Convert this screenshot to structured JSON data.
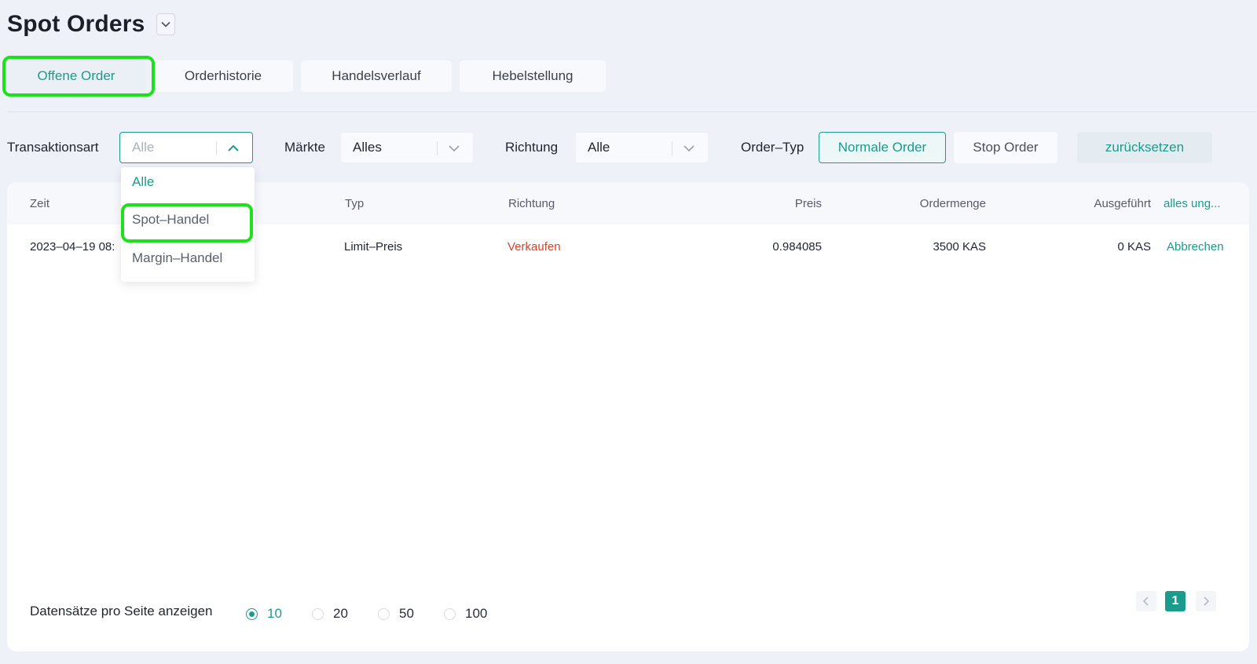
{
  "header": {
    "title": "Spot Orders"
  },
  "tabs": [
    {
      "label": "Offene Order",
      "active": true
    },
    {
      "label": "Orderhistorie",
      "active": false
    },
    {
      "label": "Handelsverlauf",
      "active": false
    },
    {
      "label": "Hebelstellung",
      "active": false
    }
  ],
  "filters": {
    "transaction_label": "Transaktionsart",
    "transaction_placeholder": "Alle",
    "markets_label": "Märkte",
    "markets_value": "Alles",
    "direction_label": "Richtung",
    "direction_value": "Alle",
    "order_type_label": "Order–Typ",
    "normal_order": "Normale Order",
    "stop_order": "Stop Order",
    "reset": "zurücksetzen"
  },
  "dropdown": {
    "options": [
      "Alle",
      "Spot–Handel",
      "Margin–Handel"
    ],
    "selected": "Alle"
  },
  "table": {
    "columns": [
      "Zeit",
      "Typ",
      "Richtung",
      "Preis",
      "Ordermenge",
      "Ausgeführt",
      "alles ung..."
    ],
    "rows": [
      {
        "time": "2023–04–19 08:",
        "type": "Limit–Preis",
        "direction": "Verkaufen",
        "price": "0.984085",
        "amount": "3500 KAS",
        "executed": "0 KAS",
        "action": "Abbrechen"
      }
    ]
  },
  "footer": {
    "per_page_label": "Datensätze pro Seite anzeigen",
    "page_sizes": [
      "10",
      "20",
      "50",
      "100"
    ],
    "selected_page_size": "10",
    "current_page": "1"
  },
  "colors": {
    "accent": "#1a9b8b",
    "sell": "#d0452f",
    "highlight": "#1be21b"
  }
}
